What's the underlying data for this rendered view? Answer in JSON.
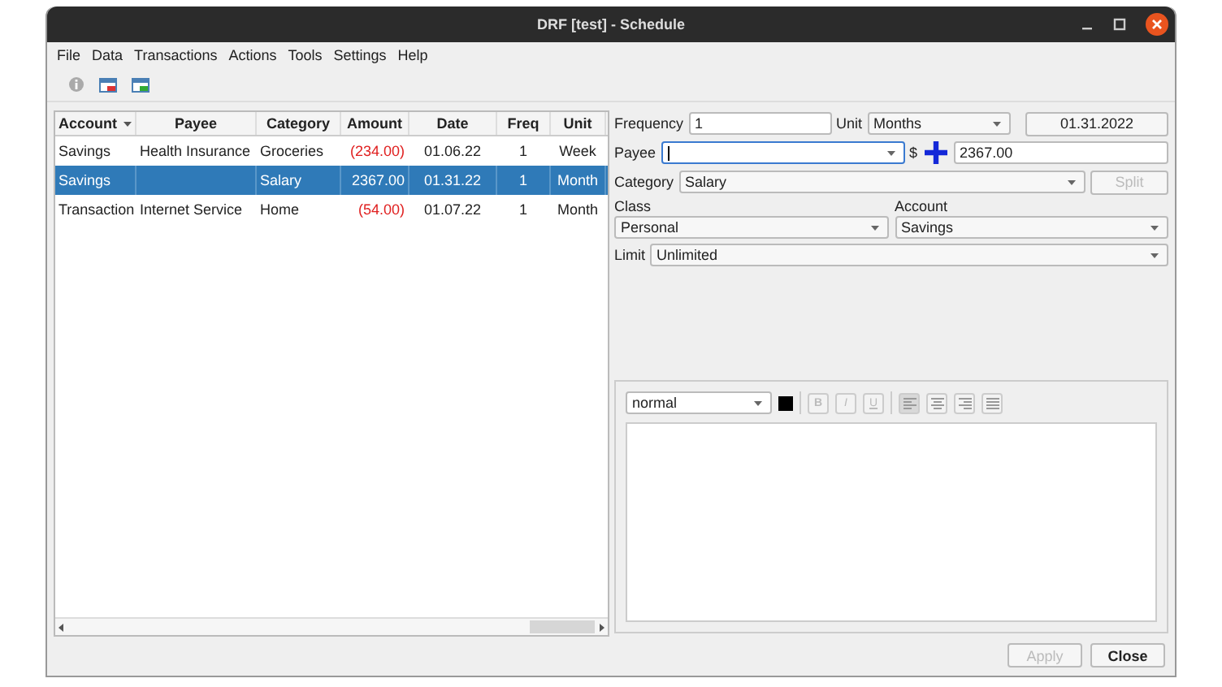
{
  "window": {
    "title": "DRF [test] - Schedule"
  },
  "menu": [
    {
      "label": "File"
    },
    {
      "label": "Data"
    },
    {
      "label": "Transactions"
    },
    {
      "label": "Actions"
    },
    {
      "label": "Tools"
    },
    {
      "label": "Settings"
    },
    {
      "label": "Help"
    }
  ],
  "table": {
    "columns": [
      {
        "label": "Account",
        "sorted": true
      },
      {
        "label": "Payee",
        "sorted": false
      },
      {
        "label": "Category",
        "sorted": false
      },
      {
        "label": "Amount",
        "sorted": false
      },
      {
        "label": "Date",
        "sorted": false
      },
      {
        "label": "Freq",
        "sorted": false
      },
      {
        "label": "Unit",
        "sorted": false
      }
    ],
    "rows": [
      {
        "cells": [
          "Savings",
          "Health Insurance",
          "Groceries",
          "(234.00)",
          "01.06.22",
          "1",
          "Week"
        ],
        "negative": true,
        "selected": false
      },
      {
        "cells": [
          "Savings",
          "",
          "Salary",
          "2367.00",
          "01.31.22",
          "1",
          "Month"
        ],
        "negative": false,
        "selected": true
      },
      {
        "cells": [
          "Transaction",
          "Internet Service",
          "Home",
          "(54.00)",
          "01.07.22",
          "1",
          "Month"
        ],
        "negative": true,
        "selected": false
      }
    ]
  },
  "form": {
    "frequency": {
      "label": "Frequency",
      "value": "1"
    },
    "unit": {
      "label": "Unit",
      "value": "Months"
    },
    "date_button": "01.31.2022",
    "payee": {
      "label": "Payee",
      "focused": true
    },
    "currency": "$",
    "amount": "2367.00",
    "category": {
      "label": "Category",
      "value": "Salary"
    },
    "split_button": {
      "label": "Split",
      "disabled": true
    },
    "class": {
      "label": "Class",
      "value": "Personal"
    },
    "account": {
      "label": "Account",
      "value": "Savings"
    },
    "limit": {
      "label": "Limit",
      "value": "Unlimited"
    }
  },
  "editor": {
    "style": "normal",
    "format_buttons": [
      {
        "label": "B",
        "kind": "bold",
        "disabled": true
      },
      {
        "label": "I",
        "kind": "italic",
        "disabled": true
      },
      {
        "label": "U",
        "kind": "underline",
        "disabled": true
      }
    ],
    "align_buttons": [
      {
        "kind": "left",
        "selected": true
      },
      {
        "kind": "center",
        "selected": false
      },
      {
        "kind": "right",
        "selected": false
      },
      {
        "kind": "justify",
        "selected": false
      }
    ]
  },
  "buttons": [
    {
      "label": "Apply",
      "disabled": true
    },
    {
      "label": "Close",
      "disabled": false
    }
  ]
}
